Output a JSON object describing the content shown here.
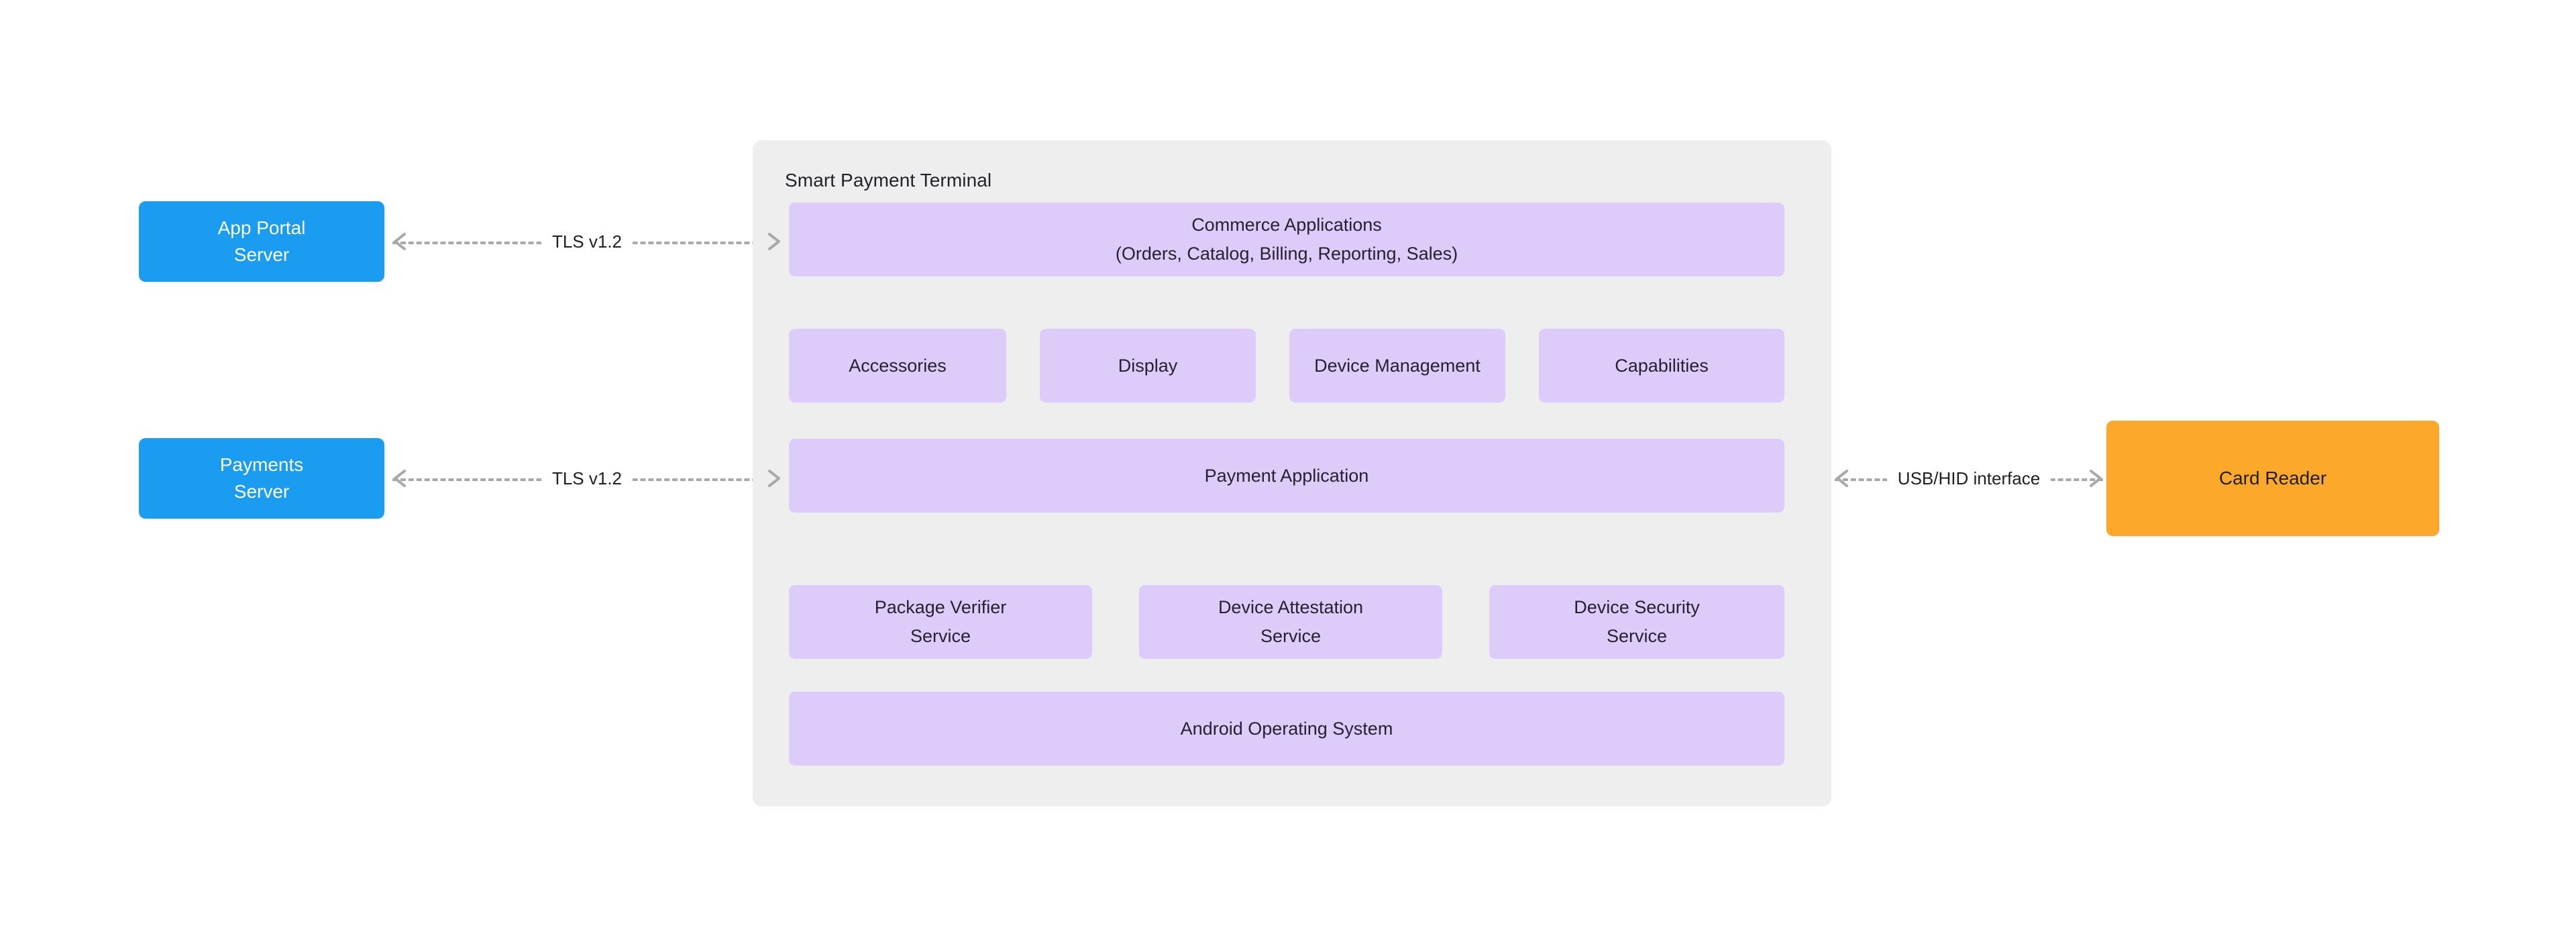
{
  "diagram": {
    "title": "Smart Payment Terminal",
    "background_color": "#ffffff",
    "container_color": "#eeeeee",
    "layer_color": "#ddcbfa",
    "external_node_color": "#1a9cf1",
    "reader_node_color": "#fba82b",
    "connector_color": "#a9a9ad"
  },
  "external_nodes": [
    {
      "id": "app-portal-server",
      "line1": "App Portal",
      "line2": "Server"
    },
    {
      "id": "payments-server",
      "line1": "Payments",
      "line2": "Server"
    }
  ],
  "peripheral_nodes": [
    {
      "id": "card-reader",
      "label": "Card Reader"
    }
  ],
  "connectors": [
    {
      "id": "tls-app-portal",
      "label": "TLS v1.2",
      "direction": "bidirectional"
    },
    {
      "id": "tls-payments",
      "label": "TLS v1.2",
      "direction": "bidirectional"
    },
    {
      "id": "usb-hid-reader",
      "label": "USB/HID interface",
      "direction": "bidirectional"
    }
  ],
  "terminal": {
    "title": "Smart Payment Terminal",
    "layers": {
      "commerce": {
        "line1": "Commerce Applications",
        "line2": "(Orders, Catalog, Billing, Reporting, Sales)"
      },
      "modules": [
        {
          "id": "accessories",
          "label": "Accessories"
        },
        {
          "id": "display",
          "label": "Display"
        },
        {
          "id": "device-management",
          "label": "Device Management"
        },
        {
          "id": "capabilities",
          "label": "Capabilities"
        }
      ],
      "payment_application": {
        "label": "Payment Application"
      },
      "services": [
        {
          "id": "package-verifier-service",
          "line1": "Package Verifier",
          "line2": "Service"
        },
        {
          "id": "device-attestation-service",
          "line1": "Device Attestation",
          "line2": "Service"
        },
        {
          "id": "device-security-service",
          "line1": "Device Security",
          "line2": "Service"
        }
      ],
      "operating_system": {
        "label": "Android Operating System"
      }
    }
  }
}
